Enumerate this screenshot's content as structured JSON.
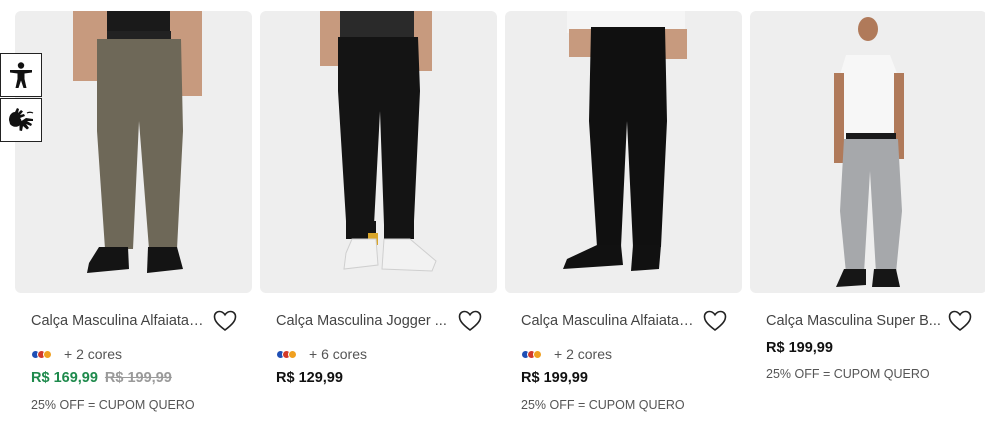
{
  "accessibility": {
    "items": [
      {
        "icon": "accessibility-person-icon"
      },
      {
        "icon": "sign-language-icon"
      }
    ]
  },
  "products": [
    {
      "title": "Calça Masculina Alfaiatari...",
      "colors_text": "+ 2 cores",
      "swatches": [
        "#1f4fb5",
        "#d23a2a",
        "#f0a020"
      ],
      "price": "R$ 169,99",
      "old_price": "R$ 199,99",
      "coupon": "25% OFF = CUPOM QUERO",
      "image": {
        "pants": "#6e6858",
        "shirt": "#1a1a1a",
        "shoes": "#141414",
        "skin": "#c79a7e"
      }
    },
    {
      "title": "Calça Masculina Jogger ...",
      "colors_text": "+ 6 cores",
      "swatches": [
        "#1f4fb5",
        "#d23a2a",
        "#f0a020"
      ],
      "price": "R$ 129,99",
      "old_price": "",
      "coupon": "",
      "image": {
        "pants": "#141414",
        "shirt": "#2a2a2a",
        "shoes": "#f2f2f2",
        "skin": "#c79a7e"
      }
    },
    {
      "title": "Calça Masculina Alfaiatari...",
      "colors_text": "+ 2 cores",
      "swatches": [
        "#1f4fb5",
        "#d23a2a",
        "#f0a020"
      ],
      "price": "R$ 199,99",
      "old_price": "",
      "coupon": "25% OFF = CUPOM QUERO",
      "image": {
        "pants": "#101010",
        "shirt": "#f5f5f5",
        "shoes": "#111111",
        "skin": "#c79a7e"
      }
    },
    {
      "title": "Calça Masculina Super B...",
      "colors_text": "",
      "swatches": [],
      "price": "R$ 199,99",
      "old_price": "",
      "coupon": "25% OFF = CUPOM QUERO",
      "image": {
        "pants": "#a6a8ab",
        "shirt": "#f7f7f7",
        "shoes": "#161616",
        "skin": "#b07a5a"
      }
    }
  ],
  "colors": {
    "sale_price": "#1e8a4c",
    "card_bg": "#eeeeee"
  }
}
